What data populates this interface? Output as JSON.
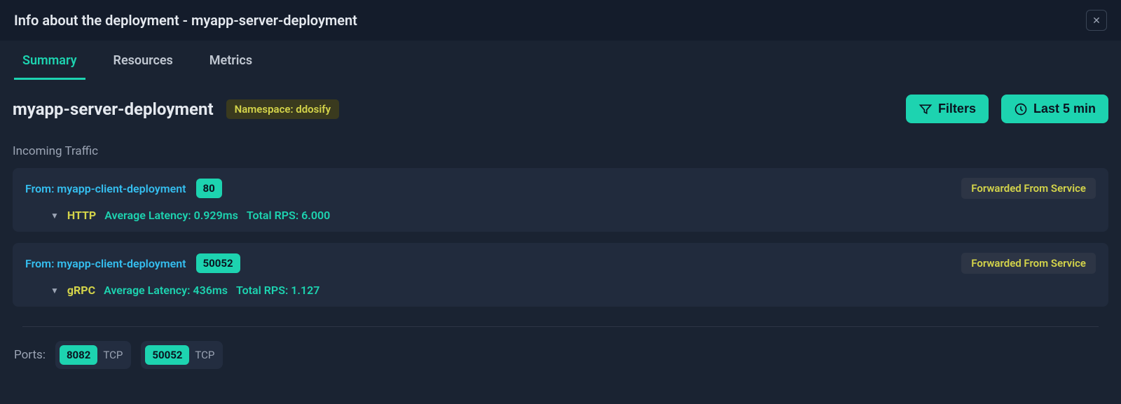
{
  "header": {
    "title": "Info about the deployment - myapp-server-deployment"
  },
  "tabs": [
    {
      "label": "Summary",
      "active": true
    },
    {
      "label": "Resources",
      "active": false
    },
    {
      "label": "Metrics",
      "active": false
    }
  ],
  "deployment": {
    "name": "myapp-server-deployment",
    "namespace_label": "Namespace: ddosify"
  },
  "actions": {
    "filters_label": "Filters",
    "timerange_label": "Last 5 min"
  },
  "incoming_traffic": {
    "title": "Incoming Traffic",
    "items": [
      {
        "from": "From: myapp-client-deployment",
        "port": "80",
        "forwarded": "Forwarded From Service",
        "protocol": "HTTP",
        "latency": "Average Latency: 0.929ms",
        "rps": "Total RPS: 6.000"
      },
      {
        "from": "From: myapp-client-deployment",
        "port": "50052",
        "forwarded": "Forwarded From Service",
        "protocol": "gRPC",
        "latency": "Average Latency: 436ms",
        "rps": "Total RPS: 1.127"
      }
    ]
  },
  "ports": {
    "label": "Ports:",
    "items": [
      {
        "port": "8082",
        "proto": "TCP"
      },
      {
        "port": "50052",
        "proto": "TCP"
      }
    ]
  }
}
